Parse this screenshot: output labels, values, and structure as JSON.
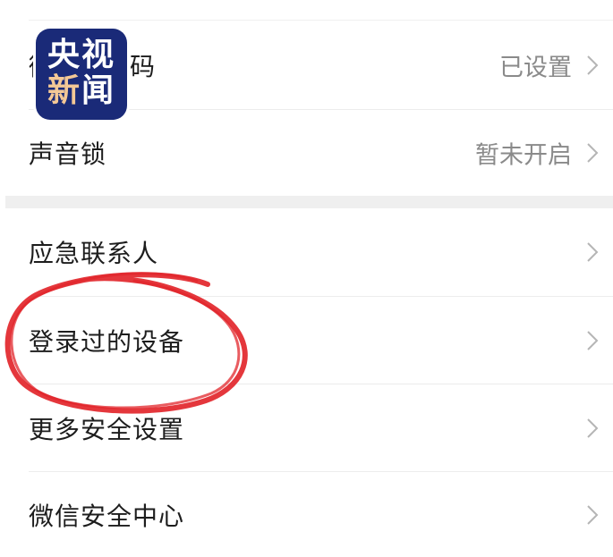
{
  "watermark": {
    "line1": "央视",
    "line2_part1": "新",
    "line2_part2": "闻"
  },
  "settings": {
    "row_partial": {
      "label_visible": "微",
      "label_tail": "码",
      "value": "已设置"
    },
    "voice_lock": {
      "label": "声音锁",
      "value": "暂未开启"
    },
    "emergency_contacts": {
      "label": "应急联系人"
    },
    "logged_devices": {
      "label": "登录过的设备"
    },
    "more_security": {
      "label": "更多安全设置"
    },
    "wechat_security_center": {
      "label": "微信安全中心"
    }
  },
  "colors": {
    "accent_circle": "#e2262b",
    "logo_bg": "#1a2a78",
    "logo_highlight": "#f4c896"
  }
}
